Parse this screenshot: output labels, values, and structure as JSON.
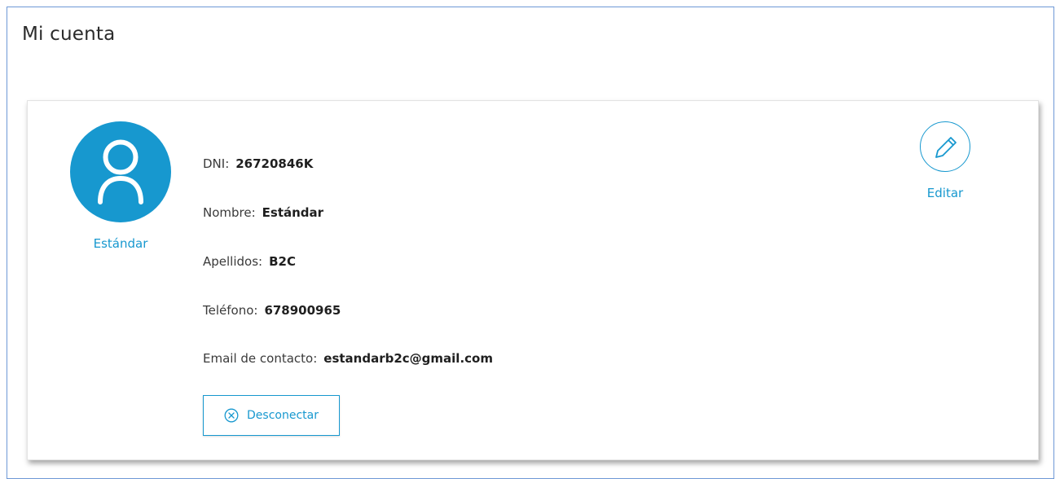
{
  "page": {
    "title": "Mi cuenta"
  },
  "profile": {
    "avatar_icon": "user-icon",
    "name": "Estándar",
    "fields": [
      {
        "label": "DNI:",
        "value": "26720846K"
      },
      {
        "label": "Nombre:",
        "value": "Estándar"
      },
      {
        "label": "Apellidos:",
        "value": "B2C"
      },
      {
        "label": "Teléfono:",
        "value": "678900965"
      },
      {
        "label": "Email de contacto:",
        "value": "estandarb2c@gmail.com"
      }
    ]
  },
  "actions": {
    "logout_label": "Desconectar",
    "logout_icon": "close-circle-icon",
    "edit_label": "Editar",
    "edit_icon": "pencil-icon"
  },
  "colors": {
    "accent": "#1798cf",
    "frame_border": "#6e98d6",
    "text": "#3a3a3a"
  }
}
